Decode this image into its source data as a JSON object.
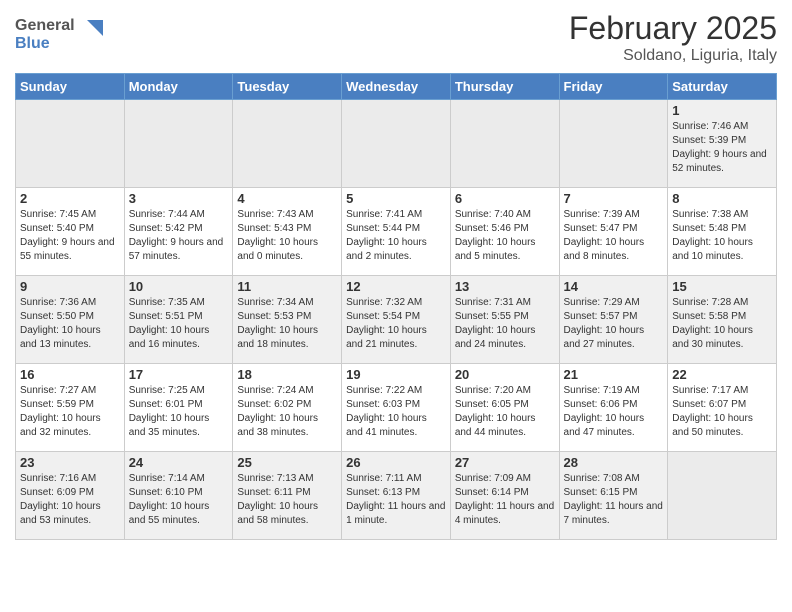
{
  "header": {
    "logo_line1": "General",
    "logo_line2": "Blue",
    "title": "February 2025",
    "subtitle": "Soldano, Liguria, Italy"
  },
  "weekdays": [
    "Sunday",
    "Monday",
    "Tuesday",
    "Wednesday",
    "Thursday",
    "Friday",
    "Saturday"
  ],
  "weeks": [
    [
      {
        "day": "",
        "info": ""
      },
      {
        "day": "",
        "info": ""
      },
      {
        "day": "",
        "info": ""
      },
      {
        "day": "",
        "info": ""
      },
      {
        "day": "",
        "info": ""
      },
      {
        "day": "",
        "info": ""
      },
      {
        "day": "1",
        "info": "Sunrise: 7:46 AM\nSunset: 5:39 PM\nDaylight: 9 hours and 52 minutes."
      }
    ],
    [
      {
        "day": "2",
        "info": "Sunrise: 7:45 AM\nSunset: 5:40 PM\nDaylight: 9 hours and 55 minutes."
      },
      {
        "day": "3",
        "info": "Sunrise: 7:44 AM\nSunset: 5:42 PM\nDaylight: 9 hours and 57 minutes."
      },
      {
        "day": "4",
        "info": "Sunrise: 7:43 AM\nSunset: 5:43 PM\nDaylight: 10 hours and 0 minutes."
      },
      {
        "day": "5",
        "info": "Sunrise: 7:41 AM\nSunset: 5:44 PM\nDaylight: 10 hours and 2 minutes."
      },
      {
        "day": "6",
        "info": "Sunrise: 7:40 AM\nSunset: 5:46 PM\nDaylight: 10 hours and 5 minutes."
      },
      {
        "day": "7",
        "info": "Sunrise: 7:39 AM\nSunset: 5:47 PM\nDaylight: 10 hours and 8 minutes."
      },
      {
        "day": "8",
        "info": "Sunrise: 7:38 AM\nSunset: 5:48 PM\nDaylight: 10 hours and 10 minutes."
      }
    ],
    [
      {
        "day": "9",
        "info": "Sunrise: 7:36 AM\nSunset: 5:50 PM\nDaylight: 10 hours and 13 minutes."
      },
      {
        "day": "10",
        "info": "Sunrise: 7:35 AM\nSunset: 5:51 PM\nDaylight: 10 hours and 16 minutes."
      },
      {
        "day": "11",
        "info": "Sunrise: 7:34 AM\nSunset: 5:53 PM\nDaylight: 10 hours and 18 minutes."
      },
      {
        "day": "12",
        "info": "Sunrise: 7:32 AM\nSunset: 5:54 PM\nDaylight: 10 hours and 21 minutes."
      },
      {
        "day": "13",
        "info": "Sunrise: 7:31 AM\nSunset: 5:55 PM\nDaylight: 10 hours and 24 minutes."
      },
      {
        "day": "14",
        "info": "Sunrise: 7:29 AM\nSunset: 5:57 PM\nDaylight: 10 hours and 27 minutes."
      },
      {
        "day": "15",
        "info": "Sunrise: 7:28 AM\nSunset: 5:58 PM\nDaylight: 10 hours and 30 minutes."
      }
    ],
    [
      {
        "day": "16",
        "info": "Sunrise: 7:27 AM\nSunset: 5:59 PM\nDaylight: 10 hours and 32 minutes."
      },
      {
        "day": "17",
        "info": "Sunrise: 7:25 AM\nSunset: 6:01 PM\nDaylight: 10 hours and 35 minutes."
      },
      {
        "day": "18",
        "info": "Sunrise: 7:24 AM\nSunset: 6:02 PM\nDaylight: 10 hours and 38 minutes."
      },
      {
        "day": "19",
        "info": "Sunrise: 7:22 AM\nSunset: 6:03 PM\nDaylight: 10 hours and 41 minutes."
      },
      {
        "day": "20",
        "info": "Sunrise: 7:20 AM\nSunset: 6:05 PM\nDaylight: 10 hours and 44 minutes."
      },
      {
        "day": "21",
        "info": "Sunrise: 7:19 AM\nSunset: 6:06 PM\nDaylight: 10 hours and 47 minutes."
      },
      {
        "day": "22",
        "info": "Sunrise: 7:17 AM\nSunset: 6:07 PM\nDaylight: 10 hours and 50 minutes."
      }
    ],
    [
      {
        "day": "23",
        "info": "Sunrise: 7:16 AM\nSunset: 6:09 PM\nDaylight: 10 hours and 53 minutes."
      },
      {
        "day": "24",
        "info": "Sunrise: 7:14 AM\nSunset: 6:10 PM\nDaylight: 10 hours and 55 minutes."
      },
      {
        "day": "25",
        "info": "Sunrise: 7:13 AM\nSunset: 6:11 PM\nDaylight: 10 hours and 58 minutes."
      },
      {
        "day": "26",
        "info": "Sunrise: 7:11 AM\nSunset: 6:13 PM\nDaylight: 11 hours and 1 minute."
      },
      {
        "day": "27",
        "info": "Sunrise: 7:09 AM\nSunset: 6:14 PM\nDaylight: 11 hours and 4 minutes."
      },
      {
        "day": "28",
        "info": "Sunrise: 7:08 AM\nSunset: 6:15 PM\nDaylight: 11 hours and 7 minutes."
      },
      {
        "day": "",
        "info": ""
      }
    ]
  ]
}
